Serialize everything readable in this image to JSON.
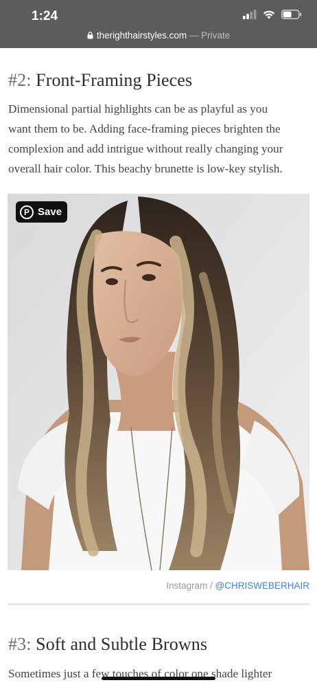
{
  "status_bar": {
    "time": "1:24"
  },
  "browser": {
    "domain": "therighthairstyles.com",
    "privacy": "— Private"
  },
  "section2": {
    "number": "#2:",
    "title": "Front-Framing Pieces",
    "paragraph_lines": [
      "Dimensional partial highlights can be as playful as you",
      "want them to be. Adding face-framing pieces brighten the",
      "complexion and add intrigue without really changing your",
      "overall hair color. This beachy brunette is low-key stylish."
    ]
  },
  "image": {
    "save_label": "Save",
    "pin_glyph": "P",
    "credit_source": "Instagram /",
    "credit_handle": "@CHRISWEBERHAIR"
  },
  "section3": {
    "number": "#3:",
    "title": "Soft and Subtle Browns",
    "paragraph_start": "Sometimes just a few touches of color one shade lighter"
  },
  "colors": {
    "status_bar": "#5c5c5c",
    "link": "#4a7fc1",
    "text": "#444444"
  }
}
